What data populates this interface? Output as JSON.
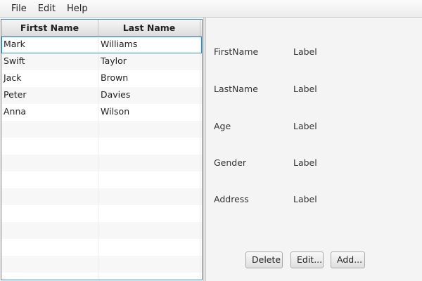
{
  "menu": {
    "items": [
      "File",
      "Edit",
      "Help"
    ]
  },
  "table": {
    "columns": [
      "Firtst Name",
      "Last Name"
    ],
    "rows": [
      [
        "Mark",
        "Williams"
      ],
      [
        "Swift",
        "Taylor"
      ],
      [
        "Jack",
        "Brown"
      ],
      [
        "Peter",
        "Davies"
      ],
      [
        "Anna",
        "Wilson"
      ]
    ],
    "selected_row": "Mark"
  },
  "details": {
    "fields": [
      {
        "key": "FirstName",
        "value": "Label"
      },
      {
        "key": "LastName",
        "value": "Label"
      },
      {
        "key": "Age",
        "value": "Label"
      },
      {
        "key": "Gender",
        "value": "Label"
      },
      {
        "key": "Address",
        "value": "Label"
      }
    ]
  },
  "buttons": {
    "delete": "Delete",
    "edit": "Edit...",
    "add": "Add..."
  },
  "colors": {
    "accent": "#3a8fc0"
  }
}
